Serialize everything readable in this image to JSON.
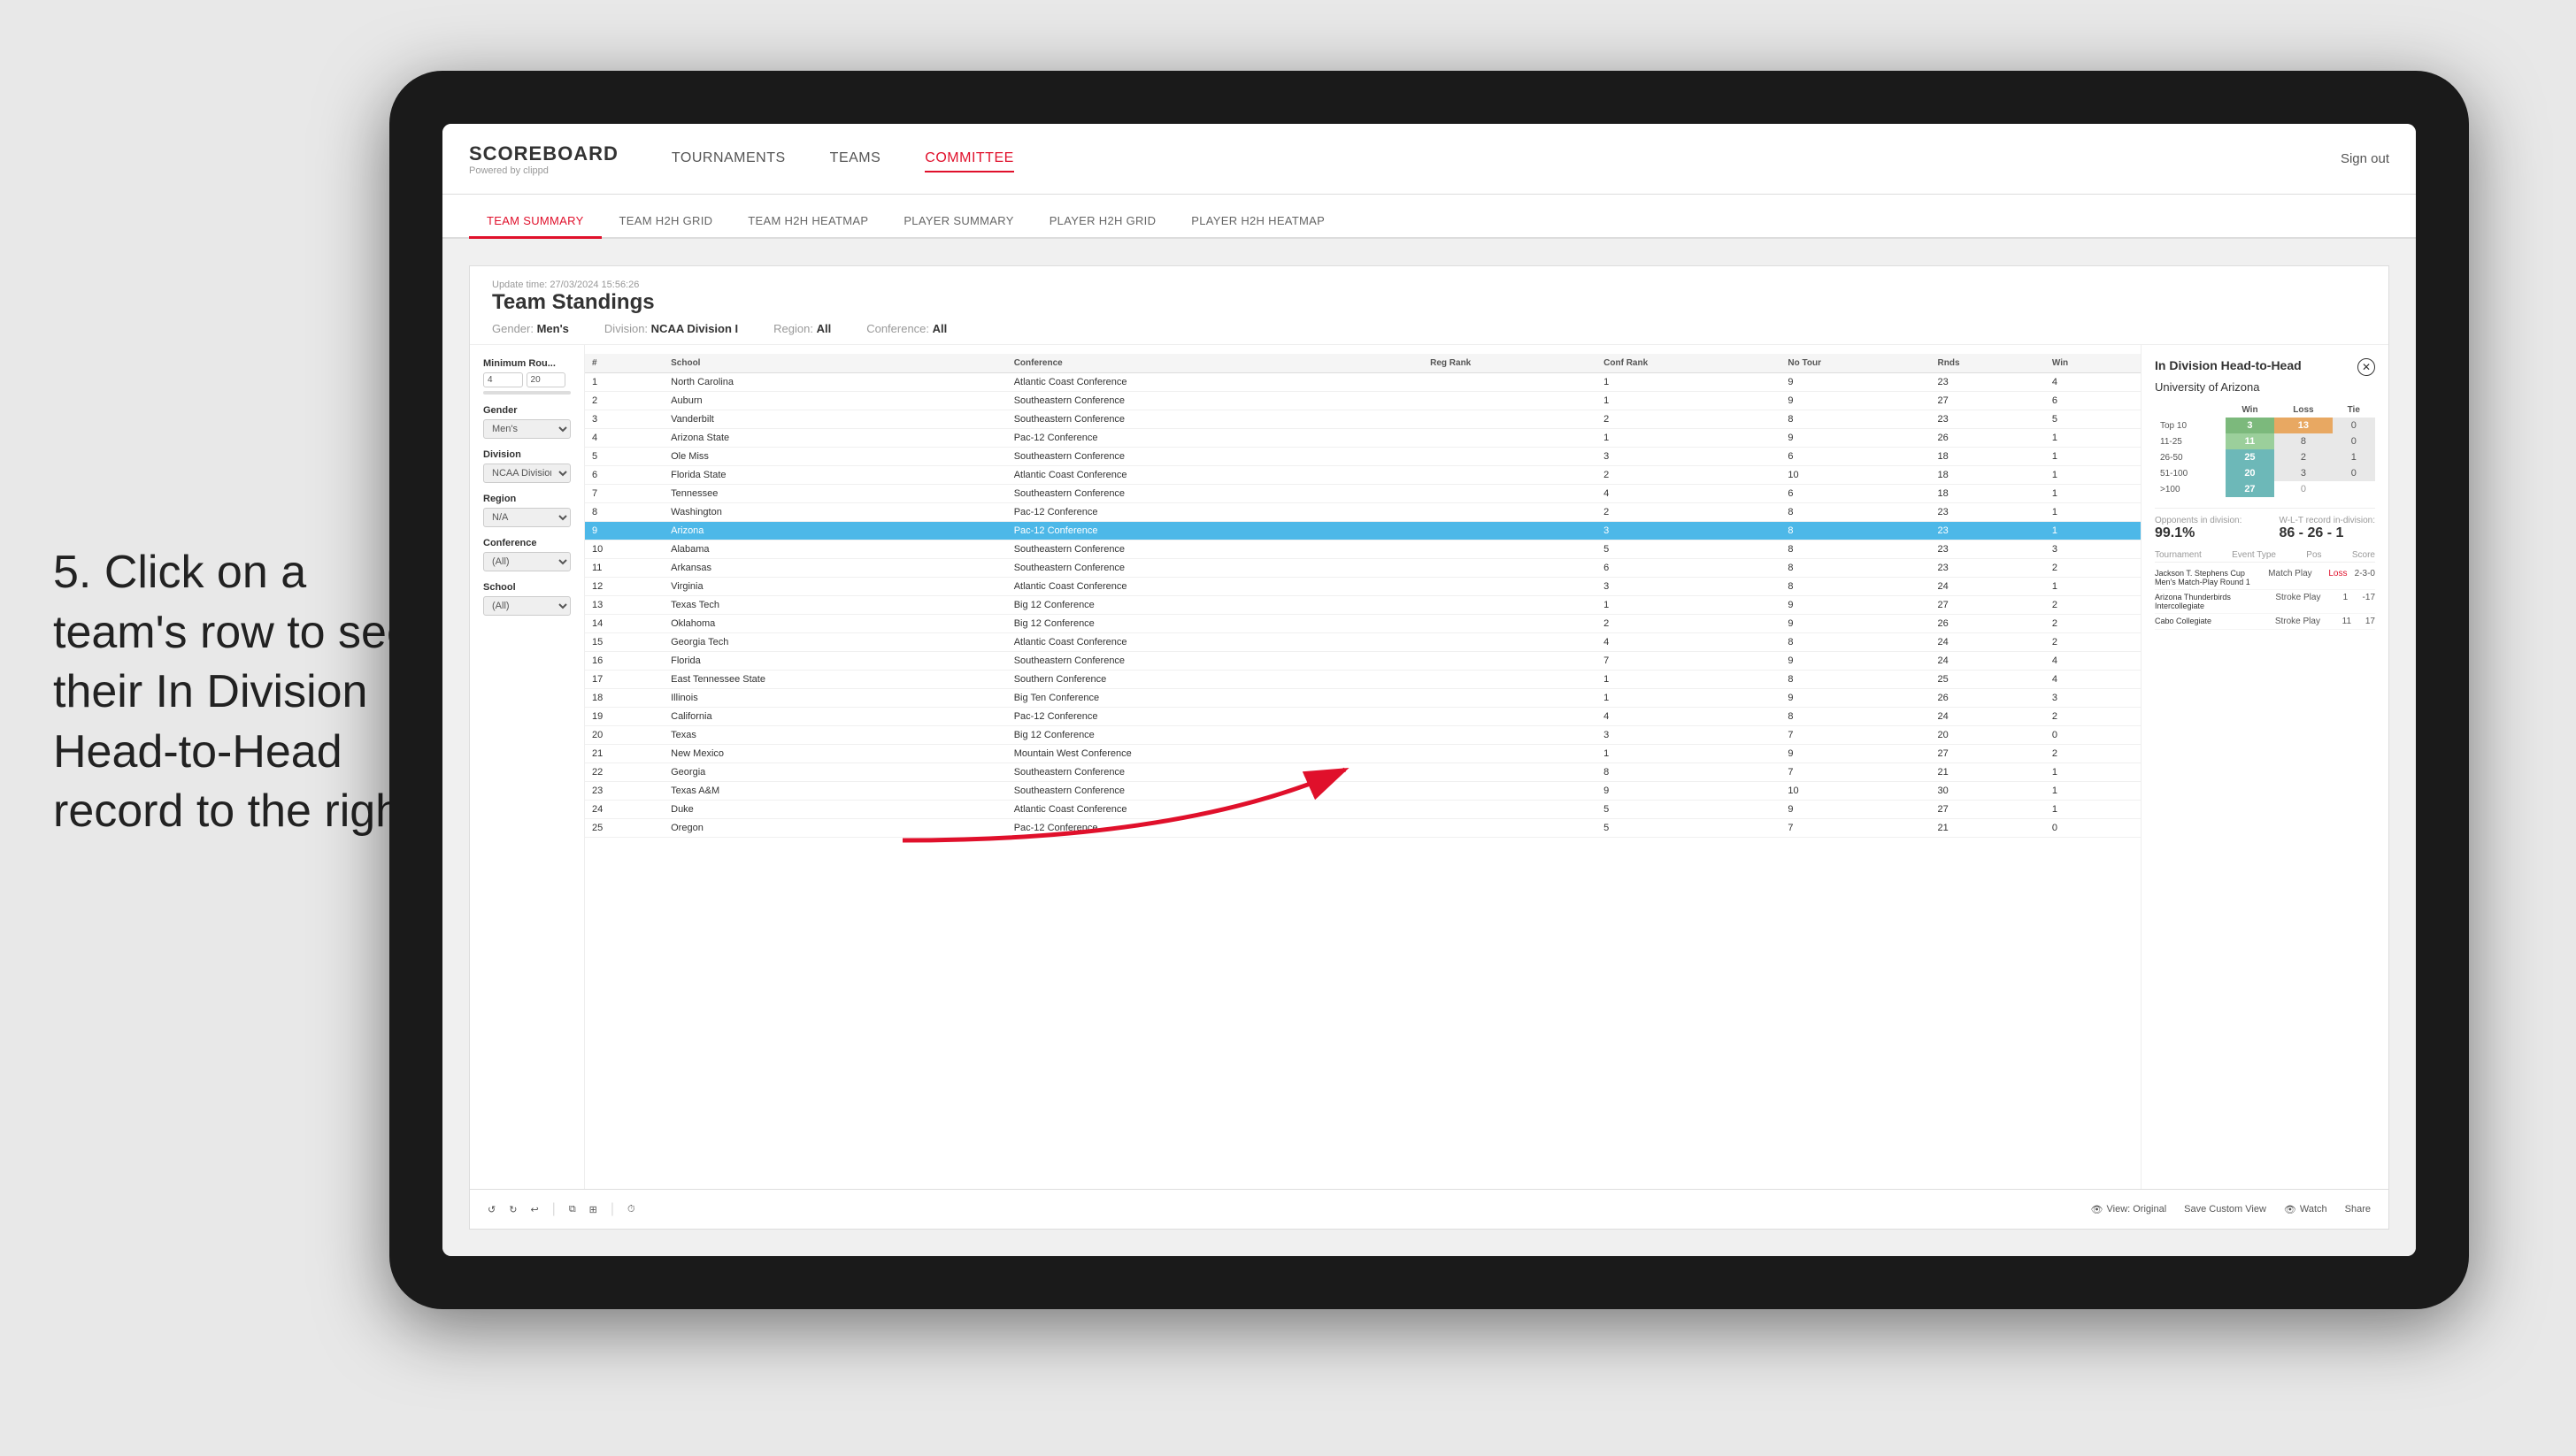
{
  "instruction": {
    "text": "5. Click on a team's row to see their In Division Head-to-Head record to the right"
  },
  "nav": {
    "logo": "SCOREBOARD",
    "logo_sub": "Powered by clippd",
    "items": [
      "TOURNAMENTS",
      "TEAMS",
      "COMMITTEE"
    ],
    "active_item": "COMMITTEE",
    "sign_out": "Sign out"
  },
  "sub_nav": {
    "items": [
      "TEAM SUMMARY",
      "TEAM H2H GRID",
      "TEAM H2H HEATMAP",
      "PLAYER SUMMARY",
      "PLAYER H2H GRID",
      "PLAYER H2H HEATMAP"
    ],
    "active": "PLAYER SUMMARY"
  },
  "panel": {
    "update_time": "Update time: 27/03/2024 15:56:26",
    "title": "Team Standings",
    "filters": {
      "gender": "Men's",
      "division": "NCAA Division I",
      "region": "All",
      "conference": "All"
    }
  },
  "filter_sidebar": {
    "minimum_rounds_label": "Minimum Rou...",
    "min_val": "4",
    "max_val": "20",
    "gender_label": "Gender",
    "gender_val": "Men's",
    "division_label": "Division",
    "division_val": "NCAA Division I",
    "region_label": "Region",
    "region_val": "N/A",
    "conference_label": "Conference",
    "conference_val": "(All)",
    "school_label": "School",
    "school_val": "(All)"
  },
  "table": {
    "columns": [
      "#",
      "School",
      "Conference",
      "Reg Rank",
      "Conf Rank",
      "No Tour",
      "Rnds",
      "Win"
    ],
    "rows": [
      {
        "rank": 1,
        "school": "North Carolina",
        "conference": "Atlantic Coast Conference",
        "reg_rank": "",
        "conf_rank": "1",
        "no_tour": "9",
        "rnds": "23",
        "win": "4",
        "highlighted": false
      },
      {
        "rank": 2,
        "school": "Auburn",
        "conference": "Southeastern Conference",
        "reg_rank": "",
        "conf_rank": "1",
        "no_tour": "9",
        "rnds": "27",
        "win": "6",
        "highlighted": false
      },
      {
        "rank": 3,
        "school": "Vanderbilt",
        "conference": "Southeastern Conference",
        "reg_rank": "",
        "conf_rank": "2",
        "no_tour": "8",
        "rnds": "23",
        "win": "5",
        "highlighted": false
      },
      {
        "rank": 4,
        "school": "Arizona State",
        "conference": "Pac-12 Conference",
        "reg_rank": "",
        "conf_rank": "1",
        "no_tour": "9",
        "rnds": "26",
        "win": "1",
        "highlighted": false
      },
      {
        "rank": 5,
        "school": "Ole Miss",
        "conference": "Southeastern Conference",
        "reg_rank": "",
        "conf_rank": "3",
        "no_tour": "6",
        "rnds": "18",
        "win": "1",
        "highlighted": false
      },
      {
        "rank": 6,
        "school": "Florida State",
        "conference": "Atlantic Coast Conference",
        "reg_rank": "",
        "conf_rank": "2",
        "no_tour": "10",
        "rnds": "18",
        "win": "1",
        "highlighted": false
      },
      {
        "rank": 7,
        "school": "Tennessee",
        "conference": "Southeastern Conference",
        "reg_rank": "",
        "conf_rank": "4",
        "no_tour": "6",
        "rnds": "18",
        "win": "1",
        "highlighted": false
      },
      {
        "rank": 8,
        "school": "Washington",
        "conference": "Pac-12 Conference",
        "reg_rank": "",
        "conf_rank": "2",
        "no_tour": "8",
        "rnds": "23",
        "win": "1",
        "highlighted": false
      },
      {
        "rank": 9,
        "school": "Arizona",
        "conference": "Pac-12 Conference",
        "reg_rank": "",
        "conf_rank": "3",
        "no_tour": "8",
        "rnds": "23",
        "win": "1",
        "highlighted": true
      },
      {
        "rank": 10,
        "school": "Alabama",
        "conference": "Southeastern Conference",
        "reg_rank": "",
        "conf_rank": "5",
        "no_tour": "8",
        "rnds": "23",
        "win": "3",
        "highlighted": false
      },
      {
        "rank": 11,
        "school": "Arkansas",
        "conference": "Southeastern Conference",
        "reg_rank": "",
        "conf_rank": "6",
        "no_tour": "8",
        "rnds": "23",
        "win": "2",
        "highlighted": false
      },
      {
        "rank": 12,
        "school": "Virginia",
        "conference": "Atlantic Coast Conference",
        "reg_rank": "",
        "conf_rank": "3",
        "no_tour": "8",
        "rnds": "24",
        "win": "1",
        "highlighted": false
      },
      {
        "rank": 13,
        "school": "Texas Tech",
        "conference": "Big 12 Conference",
        "reg_rank": "",
        "conf_rank": "1",
        "no_tour": "9",
        "rnds": "27",
        "win": "2",
        "highlighted": false
      },
      {
        "rank": 14,
        "school": "Oklahoma",
        "conference": "Big 12 Conference",
        "reg_rank": "",
        "conf_rank": "2",
        "no_tour": "9",
        "rnds": "26",
        "win": "2",
        "highlighted": false
      },
      {
        "rank": 15,
        "school": "Georgia Tech",
        "conference": "Atlantic Coast Conference",
        "reg_rank": "",
        "conf_rank": "4",
        "no_tour": "8",
        "rnds": "24",
        "win": "2",
        "highlighted": false
      },
      {
        "rank": 16,
        "school": "Florida",
        "conference": "Southeastern Conference",
        "reg_rank": "",
        "conf_rank": "7",
        "no_tour": "9",
        "rnds": "24",
        "win": "4",
        "highlighted": false
      },
      {
        "rank": 17,
        "school": "East Tennessee State",
        "conference": "Southern Conference",
        "reg_rank": "",
        "conf_rank": "1",
        "no_tour": "8",
        "rnds": "25",
        "win": "4",
        "highlighted": false
      },
      {
        "rank": 18,
        "school": "Illinois",
        "conference": "Big Ten Conference",
        "reg_rank": "",
        "conf_rank": "1",
        "no_tour": "9",
        "rnds": "26",
        "win": "3",
        "highlighted": false
      },
      {
        "rank": 19,
        "school": "California",
        "conference": "Pac-12 Conference",
        "reg_rank": "",
        "conf_rank": "4",
        "no_tour": "8",
        "rnds": "24",
        "win": "2",
        "highlighted": false
      },
      {
        "rank": 20,
        "school": "Texas",
        "conference": "Big 12 Conference",
        "reg_rank": "",
        "conf_rank": "3",
        "no_tour": "7",
        "rnds": "20",
        "win": "0",
        "highlighted": false
      },
      {
        "rank": 21,
        "school": "New Mexico",
        "conference": "Mountain West Conference",
        "reg_rank": "",
        "conf_rank": "1",
        "no_tour": "9",
        "rnds": "27",
        "win": "2",
        "highlighted": false
      },
      {
        "rank": 22,
        "school": "Georgia",
        "conference": "Southeastern Conference",
        "reg_rank": "",
        "conf_rank": "8",
        "no_tour": "7",
        "rnds": "21",
        "win": "1",
        "highlighted": false
      },
      {
        "rank": 23,
        "school": "Texas A&M",
        "conference": "Southeastern Conference",
        "reg_rank": "",
        "conf_rank": "9",
        "no_tour": "10",
        "rnds": "30",
        "win": "1",
        "highlighted": false
      },
      {
        "rank": 24,
        "school": "Duke",
        "conference": "Atlantic Coast Conference",
        "reg_rank": "",
        "conf_rank": "5",
        "no_tour": "9",
        "rnds": "27",
        "win": "1",
        "highlighted": false
      },
      {
        "rank": 25,
        "school": "Oregon",
        "conference": "Pac-12 Conference",
        "reg_rank": "",
        "conf_rank": "5",
        "no_tour": "7",
        "rnds": "21",
        "win": "0",
        "highlighted": false
      }
    ]
  },
  "h2h": {
    "title": "In Division Head-to-Head",
    "team": "University of Arizona",
    "tiers": [
      {
        "label": "Top 10",
        "win": "3",
        "loss": "13",
        "tie": "0",
        "win_class": "green",
        "loss_class": "orange"
      },
      {
        "label": "11-25",
        "win": "11",
        "loss": "8",
        "tie": "0",
        "win_class": "lt-green",
        "loss_class": "gray"
      },
      {
        "label": "26-50",
        "win": "25",
        "loss": "2",
        "tie": "1",
        "win_class": "blue-green",
        "loss_class": "gray"
      },
      {
        "label": "51-100",
        "win": "20",
        "loss": "3",
        "tie": "0",
        "win_class": "blue-green",
        "loss_class": "gray"
      },
      {
        "label": ">100",
        "win": "27",
        "loss": "0",
        "tie": "",
        "win_class": "blue-green",
        "loss_class": "zero"
      }
    ],
    "opponents_label": "Opponents in division:",
    "opponents_val": "99.1%",
    "record_label": "W-L-T record in-division:",
    "record_val": "86 - 26 - 1",
    "tournaments": [
      {
        "name": "Jackson T. Stephens Cup Men's Match-Play Round",
        "type": "Match Play",
        "result": "Loss",
        "score": "2-3-0"
      },
      {
        "name": "Arizona Thunderbirds Intercollegiate",
        "type": "Stroke Play",
        "pos": "1",
        "score": "-17"
      },
      {
        "name": "Cabo Collegiate",
        "type": "Stroke Play",
        "pos": "11",
        "score": "17"
      }
    ]
  },
  "toolbar": {
    "undo": "↺",
    "view_original": "View: Original",
    "save_custom": "Save Custom View",
    "watch": "Watch",
    "share": "Share"
  }
}
